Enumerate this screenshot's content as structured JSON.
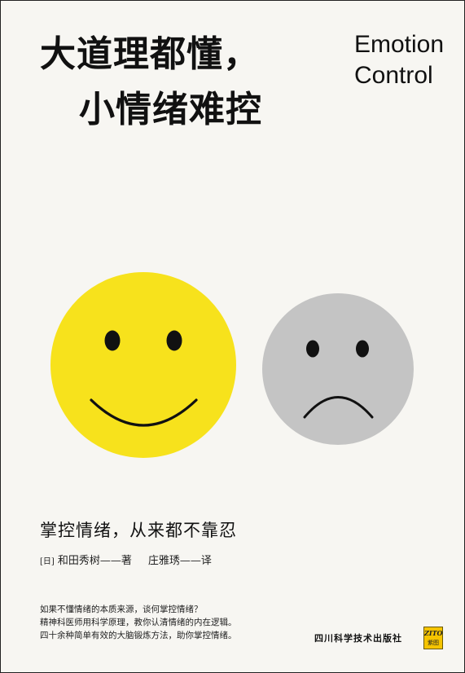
{
  "title": {
    "line1": "大道理都懂，",
    "line2": "小情绪难控"
  },
  "english_title": {
    "line1": "Emotion",
    "line2": "Control"
  },
  "faces": {
    "happy_color": "#f7e21c",
    "sad_color": "#c4c4c4",
    "ink_color": "#111111"
  },
  "slogan": "掌控情绪，从来都不靠忍",
  "authors": {
    "nationality": "[日]",
    "author": "和田秀树——著",
    "translator": "庄雅琇——译"
  },
  "blurb": [
    "如果不懂情绪的本质来源，谈何掌控情绪？",
    "精神科医师用科学原理，教你认清情绪的内在逻辑。",
    "四十余种简单有效的大脑锻炼方法，助你掌控情绪。"
  ],
  "publisher": "四川科学技术出版社",
  "imprint_logo": {
    "mark": "ZITO",
    "name": "紫图",
    "color": "#f5c400"
  }
}
